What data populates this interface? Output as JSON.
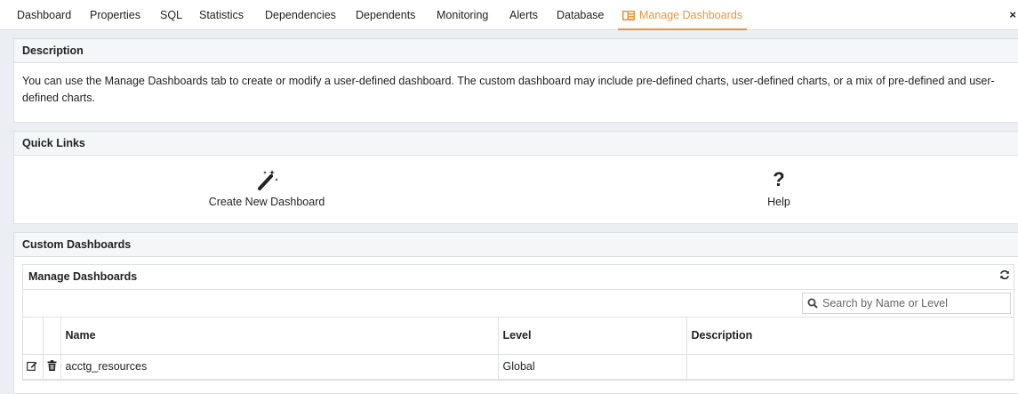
{
  "tabs": [
    {
      "label": "Dashboard"
    },
    {
      "label": "Properties"
    },
    {
      "label": "SQL"
    },
    {
      "label": "Statistics"
    },
    {
      "label": "Dependencies"
    },
    {
      "label": "Dependents"
    },
    {
      "label": "Monitoring"
    },
    {
      "label": "Alerts"
    },
    {
      "label": "Database"
    },
    {
      "label": "Manage Dashboards",
      "icon": "dashboard-icon",
      "active": true
    }
  ],
  "tab_close": "×",
  "description": {
    "title": "Description",
    "text": "You can use the Manage Dashboards tab to create or modify a user-defined dashboard. The custom dashboard may include pre-defined charts, user-defined charts, or a mix of pre-defined and user-defined charts."
  },
  "quick_links": {
    "title": "Quick Links",
    "create": {
      "label": "Create New Dashboard",
      "icon": "magic-wand-icon"
    },
    "help": {
      "label": "Help",
      "icon": "question-mark-icon",
      "glyph": "?"
    }
  },
  "custom_dashboards": {
    "title": "Custom Dashboards",
    "manage": {
      "title": "Manage Dashboards",
      "refresh_icon": "refresh-icon",
      "search_placeholder": "Search by Name or Level",
      "columns": {
        "name": "Name",
        "level": "Level",
        "description": "Description"
      },
      "rows": [
        {
          "name": "acctg_resources",
          "level": "Global",
          "description": "",
          "actions": [
            "edit-icon",
            "trash-icon"
          ]
        }
      ]
    }
  },
  "colors": {
    "accent": "#e8963a",
    "panel_header_bg": "#f5f6f8",
    "border": "#dde0e6",
    "app_bg": "#ebeef3"
  }
}
